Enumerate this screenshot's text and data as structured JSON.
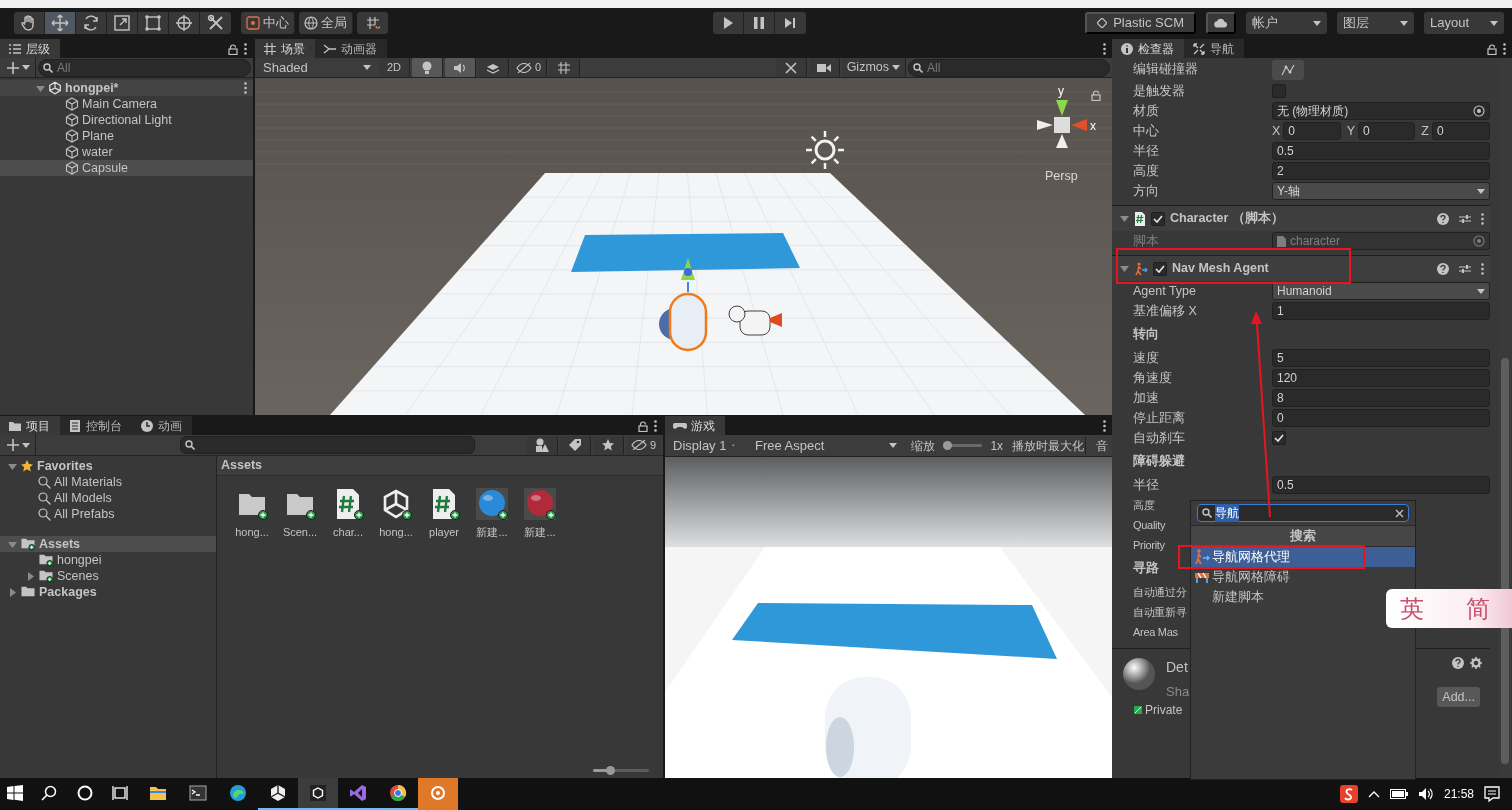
{
  "toolbar": {
    "tools": [
      {
        "kind": "hand",
        "selected": false
      },
      {
        "kind": "move",
        "selected": true
      },
      {
        "kind": "rotate",
        "selected": false
      },
      {
        "kind": "scale",
        "selected": false
      },
      {
        "kind": "rect",
        "selected": false
      },
      {
        "kind": "transform",
        "selected": false
      },
      {
        "kind": "custom",
        "selected": false
      }
    ],
    "pivot": "中心",
    "space": "全局",
    "playback": [
      {
        "kind": "play",
        "selected": false
      },
      {
        "kind": "pause",
        "selected": false
      },
      {
        "kind": "step",
        "selected": false
      }
    ],
    "plastic": "Plastic SCM",
    "account": "帐户",
    "layers": "图层",
    "layout": "Layout"
  },
  "hierarchy": {
    "tabs": [
      {
        "label": "层级",
        "selected": true
      }
    ],
    "search": {
      "placeholder": "All"
    },
    "scene": {
      "name": "hongpei*",
      "expanded": true,
      "children": [
        {
          "name": "Main Camera",
          "selected": false
        },
        {
          "name": "Directional Light",
          "selected": false
        },
        {
          "name": "Plane",
          "selected": false
        },
        {
          "name": "water",
          "selected": false
        },
        {
          "name": "Capsule",
          "selected": true
        }
      ]
    }
  },
  "scene_view": {
    "tabs": [
      {
        "label": "场景",
        "selected": true
      },
      {
        "label": "动画器",
        "selected": false
      }
    ],
    "shading": "Shaded",
    "mode_2d": "2D",
    "lighting_on": true,
    "audio_on": true,
    "hidden_count": "0",
    "gizmos": "Gizmos",
    "search": {
      "placeholder": "All"
    },
    "axis_labels": [
      "y",
      "x"
    ],
    "projection": "Persp"
  },
  "inspector": {
    "tabs": [
      {
        "label": "检查器",
        "selected": true
      },
      {
        "label": "导航",
        "selected": false
      }
    ],
    "rows": [
      {
        "kind": "button",
        "label": "编辑碰撞器"
      },
      {
        "kind": "checkbox",
        "label": "是触发器",
        "checked": false
      },
      {
        "kind": "object",
        "label": "材质",
        "value": "无 (物理材质)"
      },
      {
        "kind": "vector3",
        "label": "中心",
        "axes": [
          {
            "axis": "X",
            "value": "0"
          },
          {
            "axis": "Y",
            "value": "0"
          },
          {
            "axis": "Z",
            "value": "0"
          }
        ]
      },
      {
        "kind": "text",
        "label": "半径",
        "value": "0.5"
      },
      {
        "kind": "text",
        "label": "高度",
        "value": "2"
      },
      {
        "kind": "dropdown",
        "label": "方向",
        "value": "Y-轴"
      },
      {
        "kind": "script_component",
        "title": "Character （脚本）",
        "enabled": true
      },
      {
        "kind": "object",
        "label": "脚本",
        "value": "character",
        "disabled": true
      },
      {
        "kind": "agent_component",
        "title": "Nav Mesh Agent",
        "enabled": true
      },
      {
        "kind": "dropdown",
        "label": "Agent Type",
        "value": "Humanoid"
      },
      {
        "kind": "text",
        "label": "基准偏移 X",
        "value": "1"
      },
      {
        "kind": "section",
        "label": "转向"
      },
      {
        "kind": "text",
        "label": "速度",
        "value": "5"
      },
      {
        "kind": "text",
        "label": "角速度",
        "value": "120"
      },
      {
        "kind": "text",
        "label": "加速",
        "value": "8"
      },
      {
        "kind": "text",
        "label": "停止距离",
        "value": "0"
      },
      {
        "kind": "checkbox",
        "label": "自动刹车",
        "checked": true
      },
      {
        "kind": "section",
        "label": "障碍躲避"
      },
      {
        "kind": "text",
        "label": "半径",
        "value": "0.5"
      },
      {
        "kind": "covered",
        "label": "高度"
      },
      {
        "kind": "covered",
        "label": "Quality"
      },
      {
        "kind": "covered",
        "label": "Priority"
      },
      {
        "kind": "section",
        "label": "寻路"
      },
      {
        "kind": "covered",
        "label": "自动通过分"
      },
      {
        "kind": "covered",
        "label": "自动重新寻"
      },
      {
        "kind": "covered",
        "label": "Area Mas"
      }
    ],
    "material": {
      "name": "Det",
      "shader": "Sha",
      "tag": "Private",
      "add_button": "Add..."
    }
  },
  "add_component_popup": {
    "search": {
      "value": "导航"
    },
    "header": "搜索",
    "items": [
      {
        "label": "导航网格代理",
        "kind": "agent",
        "selected": true
      },
      {
        "label": "导航网格障碍",
        "kind": "obstacle",
        "selected": false
      },
      {
        "label": "新建脚本",
        "kind": "plain",
        "selected": false
      }
    ]
  },
  "ime_bar": [
    "英",
    "简"
  ],
  "project": {
    "tabs": [
      {
        "label": "项目",
        "selected": true
      },
      {
        "label": "控制台",
        "selected": false
      },
      {
        "label": "动画",
        "selected": false
      }
    ],
    "hidden_count": "9",
    "tree": [
      {
        "label": "Favorites",
        "kind": "favorites",
        "expanded": true,
        "selected": false,
        "children": [
          {
            "label": "All Materials",
            "kind": "search",
            "selected": false
          },
          {
            "label": "All Models",
            "kind": "search",
            "selected": false
          },
          {
            "label": "All Prefabs",
            "kind": "search",
            "selected": false
          }
        ]
      },
      {
        "label": "Assets",
        "kind": "folder",
        "expanded": true,
        "selected": true,
        "children": [
          {
            "label": "hongpei",
            "kind": "folder",
            "selected": false
          },
          {
            "label": "Scenes",
            "kind": "folder",
            "expanded": false,
            "selected": false
          }
        ]
      },
      {
        "label": "Packages",
        "kind": "folder",
        "expanded": false,
        "selected": false
      }
    ],
    "breadcrumb": "Assets",
    "assets": [
      {
        "name": "hong...",
        "kind": "folder"
      },
      {
        "name": "Scen...",
        "kind": "folder"
      },
      {
        "name": "char...",
        "kind": "script"
      },
      {
        "name": "hong...",
        "kind": "scene"
      },
      {
        "name": "player",
        "kind": "script"
      },
      {
        "name": "新建...",
        "kind": "material",
        "color": "#2a8ad8"
      },
      {
        "name": "新建...",
        "kind": "material",
        "color": "#b02a3a"
      }
    ],
    "icon_size": {
      "level": 0.3
    }
  },
  "game_view": {
    "tabs": [
      {
        "label": "游戏",
        "selected": true
      }
    ],
    "display": "Display 1",
    "aspect": "Free Aspect",
    "scale_label": "缩放",
    "scale": {
      "level": 0.1
    },
    "scale_value": "1x",
    "maximize": "播放时最大化",
    "audio": "音"
  },
  "taskbar": {
    "apps": [
      {
        "kind": "explorer",
        "running": false,
        "selected": false
      },
      {
        "kind": "terminal",
        "running": false,
        "selected": false
      },
      {
        "kind": "edge",
        "running": false,
        "selected": false
      },
      {
        "kind": "hub",
        "running": true,
        "selected": false
      },
      {
        "kind": "unity",
        "running": true,
        "selected": true
      },
      {
        "kind": "vs",
        "running": true,
        "selected": false
      },
      {
        "kind": "chrome",
        "running": true,
        "selected": false
      },
      {
        "kind": "recorder",
        "running": false,
        "selected": true
      }
    ],
    "time": "21:58"
  }
}
